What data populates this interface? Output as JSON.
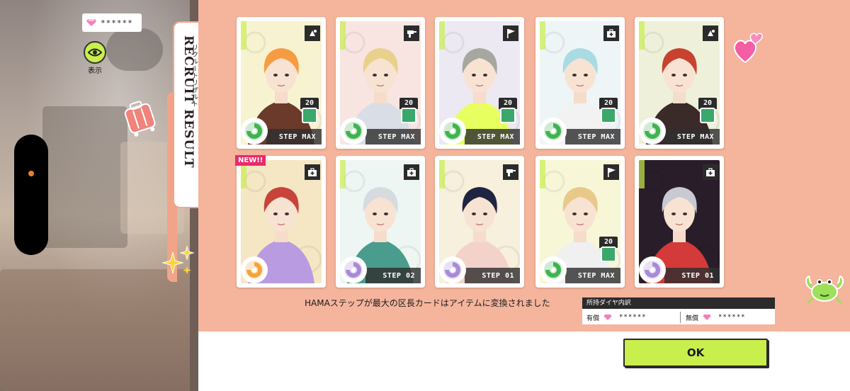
{
  "header": {
    "diamond_count": "******",
    "toggle_label": "表示"
  },
  "side_tab": {
    "title": "RECRUIT RESULT",
    "subtitle": "リクルートリザルト"
  },
  "cards": [
    {
      "step": "STEP MAX",
      "level": "20",
      "attr": "green",
      "type_icon": "star-swap-icon",
      "is_new": false,
      "palette": [
        "#f7f3d0",
        "#f79b42",
        "#6b3a2a"
      ]
    },
    {
      "step": "STEP MAX",
      "level": "20",
      "attr": "green",
      "type_icon": "drill-icon",
      "is_new": false,
      "palette": [
        "#f8e5e2",
        "#e9d08c",
        "#d9dde6"
      ]
    },
    {
      "step": "STEP MAX",
      "level": "20",
      "attr": "green",
      "type_icon": "flag-icon",
      "is_new": false,
      "palette": [
        "#ece9f3",
        "#a7a79f",
        "#e8ff60"
      ]
    },
    {
      "step": "STEP MAX",
      "level": "20",
      "attr": "green",
      "type_icon": "medkit-icon",
      "is_new": false,
      "palette": [
        "#eef5f7",
        "#a9dbe2",
        "#f2f2f2"
      ]
    },
    {
      "step": "STEP MAX",
      "level": "20",
      "attr": "green",
      "type_icon": "star-swap-icon",
      "is_new": false,
      "palette": [
        "#eef0d9",
        "#c8422f",
        "#3a2a28"
      ]
    },
    {
      "step": "",
      "level": "",
      "attr": "orange",
      "type_icon": "medkit-icon",
      "is_new": true,
      "new_label": "NEW!!",
      "palette": [
        "#f5e7c4",
        "#c8443a",
        "#b89be0"
      ]
    },
    {
      "step": "STEP 02",
      "level": "",
      "attr": "purple",
      "type_icon": "medkit-icon",
      "is_new": false,
      "palette": [
        "#eef6f4",
        "#d6dbe0",
        "#4a9c8c"
      ]
    },
    {
      "step": "STEP 01",
      "level": "",
      "attr": "purple",
      "type_icon": "drill-icon",
      "is_new": false,
      "palette": [
        "#f6f0dc",
        "#1f2540",
        "#f3d2cc"
      ]
    },
    {
      "step": "STEP MAX",
      "level": "20",
      "attr": "green",
      "type_icon": "flag-icon",
      "is_new": false,
      "palette": [
        "#f7f7d8",
        "#e8c98a",
        "#f0f0f0"
      ]
    },
    {
      "step": "STEP 01",
      "level": "",
      "attr": "purple",
      "type_icon": "medkit-icon",
      "is_new": false,
      "palette": [
        "#2a1d2a",
        "#c8c9d3",
        "#d43a3a"
      ]
    }
  ],
  "footer": {
    "message": "HAMAステップが最大の区長カードはアイテムに変換されました",
    "diamond_breakdown_title": "所持ダイヤ内訳",
    "paid_label": "有償",
    "paid_value": "******",
    "free_label": "無償",
    "free_value": "******",
    "ok_label": "OK"
  },
  "colors": {
    "panel": "#f5b49c",
    "accent_lime": "#c8ef4b",
    "attr_green": "#3fb34f",
    "attr_orange": "#f3a53a",
    "attr_purple": "#a88ad8",
    "new_badge": "#ea2a6a"
  }
}
